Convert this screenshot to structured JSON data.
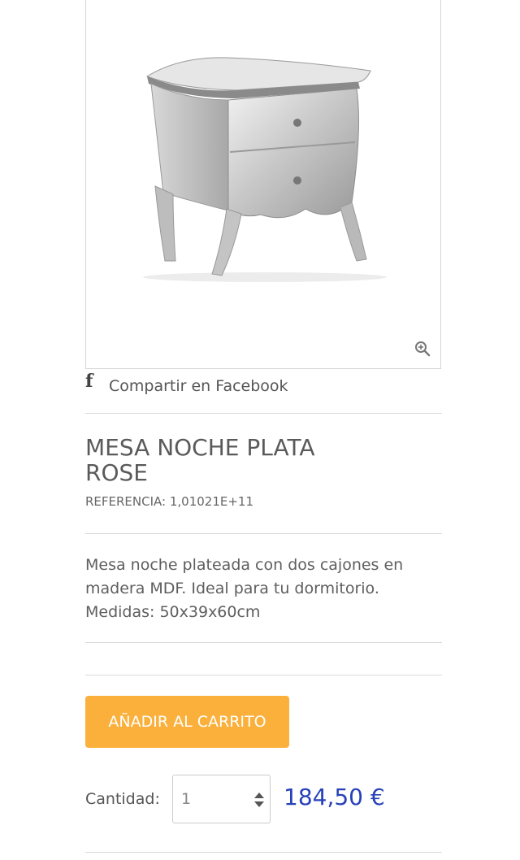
{
  "share": {
    "label": "Compartir en Facebook",
    "icon": "facebook-icon"
  },
  "product": {
    "title": "MESA NOCHE PLATA ROSE",
    "reference": "REFERENCIA: 1,01021E+11",
    "description": "Mesa noche plateada con dos cajones en madera MDF. Ideal para tu dormitorio. Medidas: 50x39x60cm"
  },
  "actions": {
    "add_to_cart_label": "AÑADIR AL CARRITO"
  },
  "quantity": {
    "label": "Cantidad:",
    "value": "1"
  },
  "price": {
    "value": "184,50 €"
  },
  "colors": {
    "accent": "#fbb03b",
    "price": "#2741b8"
  }
}
